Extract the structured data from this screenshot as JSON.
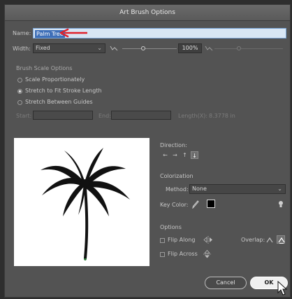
{
  "dialog": {
    "title": "Art Brush Options",
    "name_label": "Name:",
    "name_value": "Palm Tree",
    "width_label": "Width:",
    "width_option": "Fixed",
    "width_percent": "100%",
    "brush_scale": {
      "heading": "Brush Scale Options",
      "options": [
        "Scale Proportionately",
        "Stretch to Fit Stroke Length",
        "Stretch Between Guides"
      ],
      "selected_index": 1
    },
    "guides": {
      "start_label": "Start:",
      "end_label": "End:",
      "length_label": "Length(X):",
      "length_value": "8.3778 in"
    },
    "direction": {
      "label": "Direction:",
      "arrows": [
        "←",
        "→",
        "↑",
        "↓"
      ],
      "selected_index": 3
    },
    "colorization": {
      "heading": "Colorization",
      "method_label": "Method:",
      "method_value": "None",
      "keycolor_label": "Key Color:",
      "key_color": "#000000"
    },
    "options": {
      "heading": "Options",
      "flip_along": "Flip Along",
      "flip_across": "Flip Across",
      "overlap_label": "Overlap:"
    },
    "buttons": {
      "cancel": "Cancel",
      "ok": "OK"
    }
  },
  "colors": {
    "dialog_bg": "#535353",
    "selection": "#3e6fb8",
    "arrow_annotation": "#e0202a"
  }
}
